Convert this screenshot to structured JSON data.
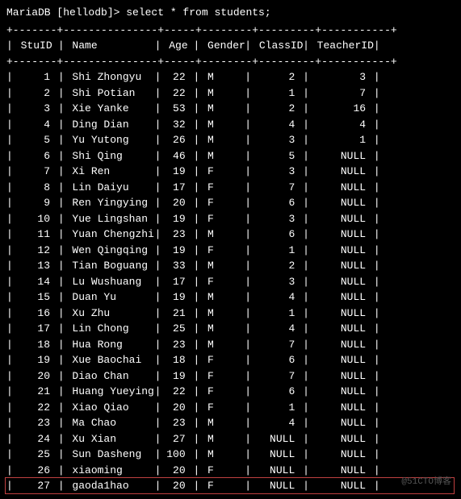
{
  "prompt": "MariaDB [hellodb]> select * from students;",
  "sep_line": "+-------+---------------+-----+--------+---------+-----------+",
  "columns": [
    "StuID",
    "Name",
    "Age",
    "Gender",
    "ClassID",
    "TeacherID"
  ],
  "rows": [
    {
      "StuID": "1",
      "Name": "Shi Zhongyu",
      "Age": "22",
      "Gender": "M",
      "ClassID": "2",
      "TeacherID": "3"
    },
    {
      "StuID": "2",
      "Name": "Shi Potian",
      "Age": "22",
      "Gender": "M",
      "ClassID": "1",
      "TeacherID": "7"
    },
    {
      "StuID": "3",
      "Name": "Xie Yanke",
      "Age": "53",
      "Gender": "M",
      "ClassID": "2",
      "TeacherID": "16"
    },
    {
      "StuID": "4",
      "Name": "Ding Dian",
      "Age": "32",
      "Gender": "M",
      "ClassID": "4",
      "TeacherID": "4"
    },
    {
      "StuID": "5",
      "Name": "Yu Yutong",
      "Age": "26",
      "Gender": "M",
      "ClassID": "3",
      "TeacherID": "1"
    },
    {
      "StuID": "6",
      "Name": "Shi Qing",
      "Age": "46",
      "Gender": "M",
      "ClassID": "5",
      "TeacherID": "NULL"
    },
    {
      "StuID": "7",
      "Name": "Xi Ren",
      "Age": "19",
      "Gender": "F",
      "ClassID": "3",
      "TeacherID": "NULL"
    },
    {
      "StuID": "8",
      "Name": "Lin Daiyu",
      "Age": "17",
      "Gender": "F",
      "ClassID": "7",
      "TeacherID": "NULL"
    },
    {
      "StuID": "9",
      "Name": "Ren Yingying",
      "Age": "20",
      "Gender": "F",
      "ClassID": "6",
      "TeacherID": "NULL"
    },
    {
      "StuID": "10",
      "Name": "Yue Lingshan",
      "Age": "19",
      "Gender": "F",
      "ClassID": "3",
      "TeacherID": "NULL"
    },
    {
      "StuID": "11",
      "Name": "Yuan Chengzhi",
      "Age": "23",
      "Gender": "M",
      "ClassID": "6",
      "TeacherID": "NULL"
    },
    {
      "StuID": "12",
      "Name": "Wen Qingqing",
      "Age": "19",
      "Gender": "F",
      "ClassID": "1",
      "TeacherID": "NULL"
    },
    {
      "StuID": "13",
      "Name": "Tian Boguang",
      "Age": "33",
      "Gender": "M",
      "ClassID": "2",
      "TeacherID": "NULL"
    },
    {
      "StuID": "14",
      "Name": "Lu Wushuang",
      "Age": "17",
      "Gender": "F",
      "ClassID": "3",
      "TeacherID": "NULL"
    },
    {
      "StuID": "15",
      "Name": "Duan Yu",
      "Age": "19",
      "Gender": "M",
      "ClassID": "4",
      "TeacherID": "NULL"
    },
    {
      "StuID": "16",
      "Name": "Xu Zhu",
      "Age": "21",
      "Gender": "M",
      "ClassID": "1",
      "TeacherID": "NULL"
    },
    {
      "StuID": "17",
      "Name": "Lin Chong",
      "Age": "25",
      "Gender": "M",
      "ClassID": "4",
      "TeacherID": "NULL"
    },
    {
      "StuID": "18",
      "Name": "Hua Rong",
      "Age": "23",
      "Gender": "M",
      "ClassID": "7",
      "TeacherID": "NULL"
    },
    {
      "StuID": "19",
      "Name": "Xue Baochai",
      "Age": "18",
      "Gender": "F",
      "ClassID": "6",
      "TeacherID": "NULL"
    },
    {
      "StuID": "20",
      "Name": "Diao Chan",
      "Age": "19",
      "Gender": "F",
      "ClassID": "7",
      "TeacherID": "NULL"
    },
    {
      "StuID": "21",
      "Name": "Huang Yueying",
      "Age": "22",
      "Gender": "F",
      "ClassID": "6",
      "TeacherID": "NULL"
    },
    {
      "StuID": "22",
      "Name": "Xiao Qiao",
      "Age": "20",
      "Gender": "F",
      "ClassID": "1",
      "TeacherID": "NULL"
    },
    {
      "StuID": "23",
      "Name": "Ma Chao",
      "Age": "23",
      "Gender": "M",
      "ClassID": "4",
      "TeacherID": "NULL"
    },
    {
      "StuID": "24",
      "Name": "Xu Xian",
      "Age": "27",
      "Gender": "M",
      "ClassID": "NULL",
      "TeacherID": "NULL"
    },
    {
      "StuID": "25",
      "Name": "Sun Dasheng",
      "Age": "100",
      "Gender": "M",
      "ClassID": "NULL",
      "TeacherID": "NULL"
    },
    {
      "StuID": "26",
      "Name": "xiaoming",
      "Age": "20",
      "Gender": "F",
      "ClassID": "NULL",
      "TeacherID": "NULL"
    },
    {
      "StuID": "27",
      "Name": "gaoda1hao",
      "Age": "20",
      "Gender": "F",
      "ClassID": "NULL",
      "TeacherID": "NULL"
    }
  ],
  "highlight_row_index": 26,
  "watermark": "@51CTO博客"
}
